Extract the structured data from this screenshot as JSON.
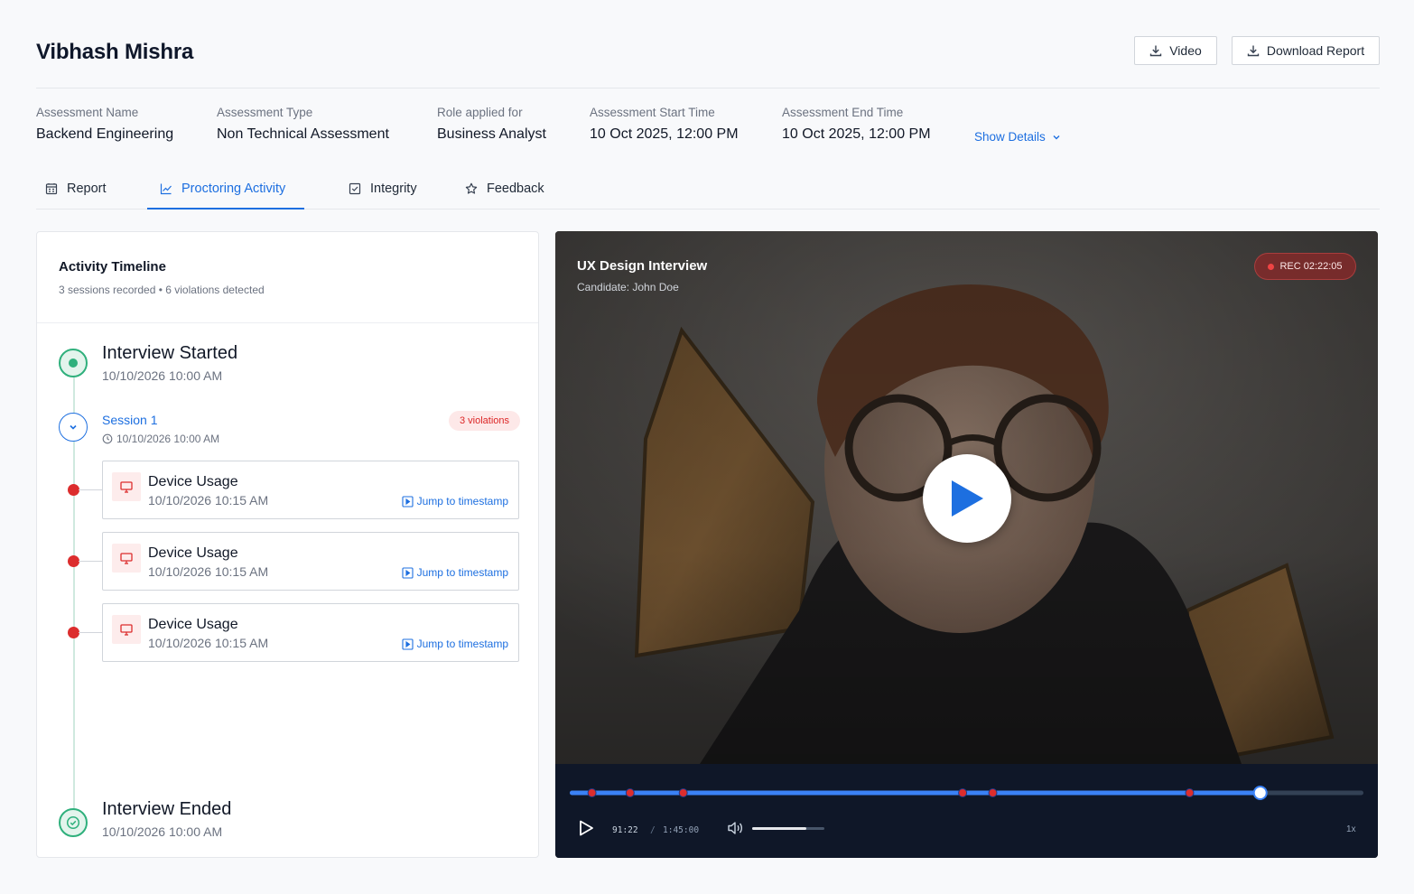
{
  "header": {
    "candidate_name": "Vibhash Mishra",
    "video_button": "Video",
    "download_report_button": "Download Report"
  },
  "meta": {
    "items": [
      {
        "label": "Assessment Name",
        "value": "Backend Engineering"
      },
      {
        "label": "Assessment Type",
        "value": "Non Technical Assessment"
      },
      {
        "label": "Role applied for",
        "value": "Business Analyst"
      },
      {
        "label": "Assessment Start Time",
        "value": "10 Oct 2025, 12:00 PM"
      },
      {
        "label": "Assessment End Time",
        "value": "10 Oct 2025, 12:00 PM"
      }
    ],
    "show_details": "Show Details"
  },
  "tabs": [
    {
      "label": "Report",
      "icon": "report-icon",
      "active": false
    },
    {
      "label": "Proctoring Activity",
      "icon": "chart-icon",
      "active": true
    },
    {
      "label": "Integrity",
      "icon": "checkbox-icon",
      "active": false
    },
    {
      "label": "Feedback",
      "icon": "star-icon",
      "active": false
    }
  ],
  "timeline": {
    "title": "Activity Timeline",
    "subtitle": "3 sessions recorded • 6 violations detected",
    "start": {
      "title": "Interview Started",
      "time": "10/10/2026 10:00 AM"
    },
    "session": {
      "label": "Session 1",
      "time": "10/10/2026 10:00 AM",
      "badge": "3 violations"
    },
    "violations": [
      {
        "title": "Device Usage",
        "time": "10/10/2026 10:15 AM",
        "jump": "Jump to timestamp"
      },
      {
        "title": "Device Usage",
        "time": "10/10/2026 10:15 AM",
        "jump": "Jump to timestamp"
      },
      {
        "title": "Device Usage",
        "time": "10/10/2026 10:15 AM",
        "jump": "Jump to timestamp"
      }
    ],
    "end": {
      "title": "Interview Ended",
      "time": "10/10/2026 10:00 AM"
    }
  },
  "video": {
    "title": "UX Design Interview",
    "candidate": "Candidate: John Doe",
    "rec": "REC 02:22:05",
    "current_time": "91:22",
    "separator": "/",
    "duration": "1:45:00",
    "speed": "1x",
    "progress": 0.87,
    "volume": 0.75,
    "violation_markers": [
      0.028,
      0.076,
      0.143,
      0.495,
      0.533,
      0.781
    ]
  },
  "colors": {
    "accent": "#1d6fe0",
    "success": "#2fb07c",
    "danger": "#dc2d2d",
    "player_bg": "#0f1728"
  }
}
